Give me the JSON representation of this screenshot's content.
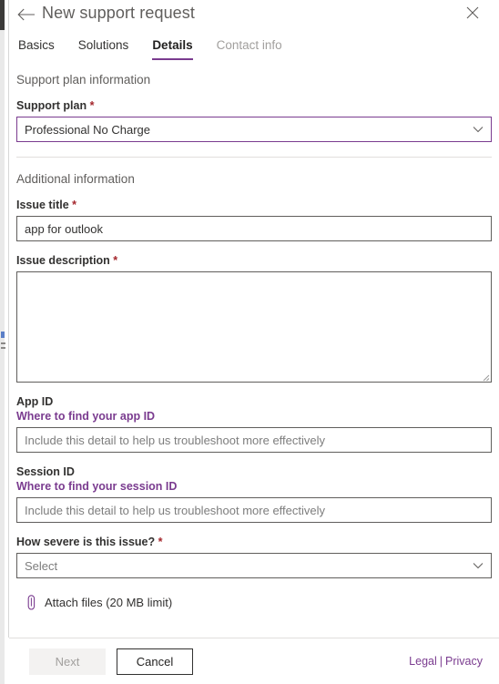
{
  "header": {
    "title": "New support request",
    "back_icon": "arrow-left-icon",
    "close_icon": "close-icon"
  },
  "tabs": [
    {
      "label": "Basics",
      "state": "enabled"
    },
    {
      "label": "Solutions",
      "state": "enabled"
    },
    {
      "label": "Details",
      "state": "active"
    },
    {
      "label": "Contact info",
      "state": "disabled"
    }
  ],
  "sections": {
    "support_plan_information": "Support plan information",
    "additional_information": "Additional information"
  },
  "fields": {
    "support_plan": {
      "label": "Support plan",
      "required": "*",
      "value": "Professional No Charge",
      "focused": true
    },
    "issue_title": {
      "label": "Issue title",
      "required": "*",
      "value": "app for outlook",
      "placeholder": ""
    },
    "issue_description": {
      "label": "Issue description",
      "required": "*",
      "value": "",
      "placeholder": ""
    },
    "app_id": {
      "label": "App ID",
      "link": "Where to find your app ID",
      "value": "",
      "placeholder": "Include this detail to help us troubleshoot more effectively"
    },
    "session_id": {
      "label": "Session ID",
      "link": "Where to find your session ID",
      "value": "",
      "placeholder": "Include this detail to help us troubleshoot more effectively"
    },
    "severity": {
      "label": "How severe is this issue?",
      "required": "*",
      "value": "Select",
      "is_placeholder": true
    }
  },
  "attach": {
    "label": "Attach files (20 MB limit)",
    "icon": "paperclip-icon"
  },
  "footer": {
    "next_label": "Next",
    "cancel_label": "Cancel",
    "legal_label": "Legal",
    "separator": "|",
    "privacy_label": "Privacy"
  },
  "colors": {
    "accent_purple": "#7a3b8f",
    "required_red": "#a4262c",
    "text_primary": "#323130",
    "text_secondary": "#605e5c",
    "text_disabled": "#a19f9d",
    "border": "#605e5c",
    "divider": "#e1dfdd"
  }
}
